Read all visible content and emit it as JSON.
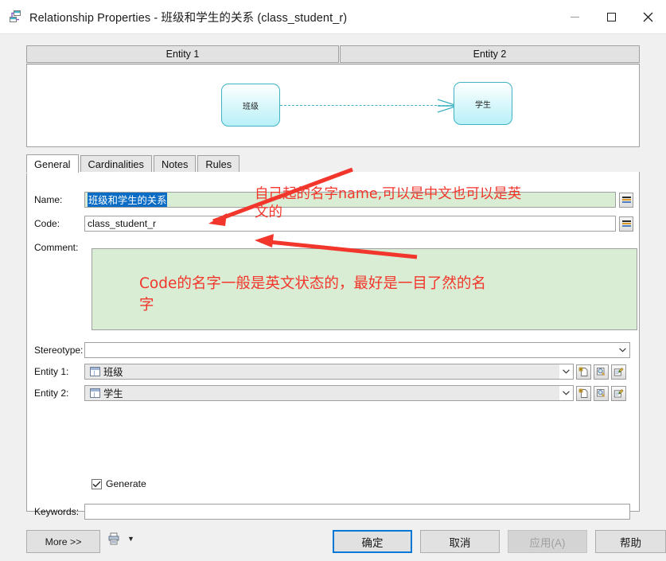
{
  "window": {
    "icon": "relationship-icon",
    "title": "Relationship Properties - 班级和学生的关系 (class_student_r)",
    "minimize_label": "—",
    "maximize_label": "□",
    "close_label": "✕"
  },
  "entity_headers": {
    "entity1": "Entity 1",
    "entity2": "Entity 2"
  },
  "diagram": {
    "left_entity": "班级",
    "right_entity": "学生",
    "relationship_style": "dashed-crowfoot",
    "entity_border_color": "#3fb3c4",
    "entity_fill_color": "#c9f4fa"
  },
  "tabs": [
    {
      "label": "General",
      "active": true
    },
    {
      "label": "Cardinalities",
      "active": false
    },
    {
      "label": "Notes",
      "active": false
    },
    {
      "label": "Rules",
      "active": false
    }
  ],
  "form": {
    "name": {
      "label": "Name:",
      "value": "班级和学生的关系",
      "selected": true,
      "equals_button": "="
    },
    "code": {
      "label": "Code:",
      "value": "class_student_r",
      "equals_button": "="
    },
    "comment": {
      "label": "Comment:",
      "value": ""
    },
    "stereotype": {
      "label": "Stereotype:",
      "value": "",
      "placeholder": ""
    },
    "entity1": {
      "label": "Entity 1:",
      "value": "班级",
      "icon": "entity-table-icon",
      "buttons": [
        "create-icon",
        "browse-icon",
        "properties-icon"
      ]
    },
    "entity2": {
      "label": "Entity 2:",
      "value": "学生",
      "icon": "entity-table-icon",
      "buttons": [
        "create-icon",
        "browse-icon",
        "properties-icon"
      ]
    },
    "generate": {
      "label": "Generate",
      "checked": true
    },
    "keywords": {
      "label": "Keywords:",
      "value": ""
    }
  },
  "footer": {
    "more": "More >>",
    "print_icon": "print-icon",
    "print_caret": "▼",
    "ok": "确定",
    "cancel": "取消",
    "apply": "应用(A)",
    "apply_disabled": true,
    "help": "帮助"
  },
  "annotations": {
    "color": "#f2362b",
    "name_note_line1": "自己起的名字name,可以是中文也可以是英",
    "name_note_line2": "文的",
    "comment_note_line1": "Code的名字一般是英文状态的，最好是一目了然的名",
    "comment_note_line2": "字"
  }
}
